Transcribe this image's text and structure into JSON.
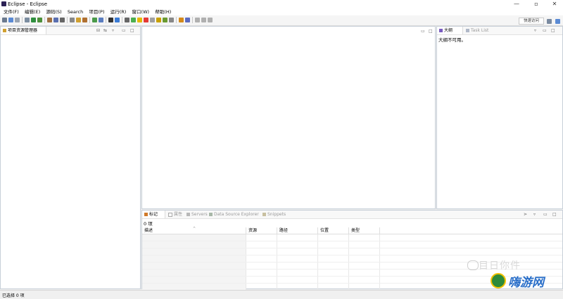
{
  "window": {
    "title": "Eclipse - Eclipse"
  },
  "menu": [
    "文件(F)",
    "编辑(E)",
    "源码(S)",
    "Search",
    "项目(P)",
    "运行(R)",
    "窗口(W)",
    "帮助(H)"
  ],
  "toolbar": {
    "quick_access": "快速访问",
    "icon_colors": [
      "#6b7a8f",
      "#5a8ad4",
      "#9aa4b2",
      "#7b8da0",
      "#2f8f3f",
      "#4c8f3a",
      "#a07040",
      "#5a6fb0",
      "#666",
      "#888",
      "#d0a030",
      "#b07030",
      "#4a9a4a",
      "#5a7dc0",
      "#333",
      "#3a7bd5",
      "#666",
      "#4caf50",
      "#e6b800",
      "#e53935",
      "#a0a0a0",
      "#c8a000",
      "#6a9a30",
      "#888",
      "#d48a1a",
      "#5c6bc0",
      "#b0b0b0",
      "#b0b0b0",
      "#b0b0b0"
    ]
  },
  "project_explorer": {
    "tab_label": "项目资源管理器",
    "tab_close": "⊠"
  },
  "outline": {
    "tab_label": "大纲",
    "tab2_label": "Task List",
    "message": "大纲不可用。"
  },
  "bottom": {
    "tabs": [
      {
        "label": "标记",
        "active": true
      },
      {
        "label": "属性",
        "active": false
      },
      {
        "label": "Servers",
        "active": false
      },
      {
        "label": "Data Source Explorer",
        "active": false
      },
      {
        "label": "Snippets",
        "active": false
      }
    ],
    "item_count": "0 项",
    "columns": [
      "描述",
      "资源",
      "路径",
      "位置",
      "类型"
    ]
  },
  "status": {
    "text": "已选择 0 项"
  },
  "watermark": {
    "line1": "目日你件",
    "line2": "嗨游网"
  }
}
